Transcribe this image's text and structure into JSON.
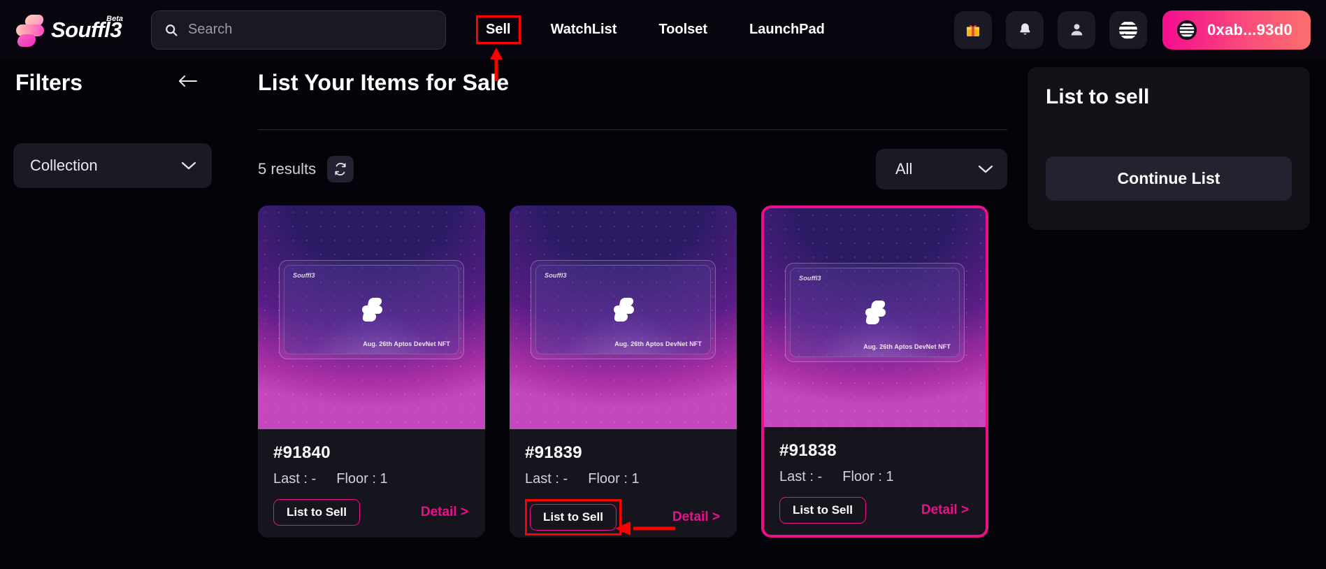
{
  "header": {
    "brand_name": "Souffl3",
    "brand_badge": "Beta",
    "search_placeholder": "Search",
    "search_value": "",
    "nav": [
      {
        "label": "Sell",
        "highlighted": true
      },
      {
        "label": "WatchList",
        "highlighted": false
      },
      {
        "label": "Toolset",
        "highlighted": false
      },
      {
        "label": "LaunchPad",
        "highlighted": false
      }
    ],
    "icons": [
      {
        "name": "gift-icon",
        "glyph": "🎁"
      },
      {
        "name": "bell-icon",
        "glyph": "🔔"
      },
      {
        "name": "person-icon",
        "glyph": "👤"
      },
      {
        "name": "aptos-logo-icon",
        "glyph": ""
      }
    ],
    "wallet_address": "0xab...93d0"
  },
  "filters": {
    "title": "Filters",
    "collection_label": "Collection"
  },
  "main": {
    "title": "List Your Items for Sale",
    "results": "5 results",
    "sort_value": "All"
  },
  "cards": [
    {
      "id": "#91840",
      "last_label": "Last : -",
      "floor_label": "Floor : 1",
      "list_button": "List to Sell",
      "detail_link": "Detail >",
      "art_brand": "Souffl3",
      "art_footer": "Aug. 26th   Aptos DevNet NFT",
      "selected": false,
      "button_highlighted": false
    },
    {
      "id": "#91839",
      "last_label": "Last : -",
      "floor_label": "Floor : 1",
      "list_button": "List to Sell",
      "detail_link": "Detail >",
      "art_brand": "Souffl3",
      "art_footer": "Aug. 26th   Aptos DevNet NFT",
      "selected": false,
      "button_highlighted": true
    },
    {
      "id": "#91838",
      "last_label": "Last : -",
      "floor_label": "Floor : 1",
      "list_button": "List to Sell",
      "detail_link": "Detail >",
      "art_brand": "Souffl3",
      "art_footer": "Aug. 26th   Aptos DevNet NFT",
      "selected": true,
      "button_highlighted": false
    }
  ],
  "right_panel": {
    "title": "List to sell",
    "continue_button": "Continue List"
  },
  "colors": {
    "accent_pink": "#ec0f8c",
    "annotation_red": "#ff0000",
    "panel_bg": "#16151d",
    "page_bg": "#05030a"
  }
}
